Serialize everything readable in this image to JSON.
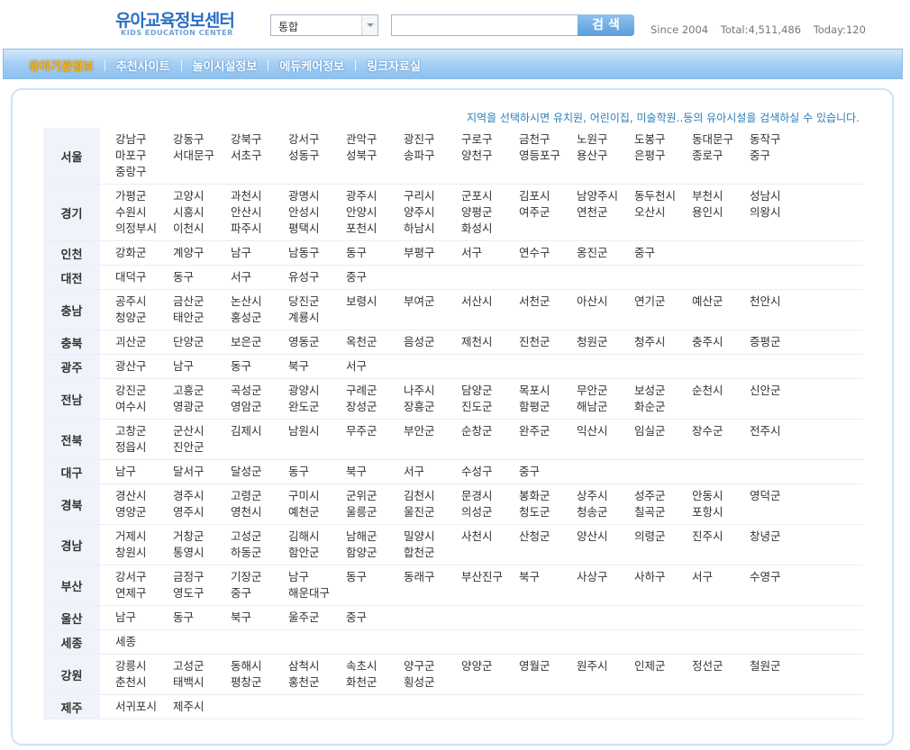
{
  "header": {
    "logo_kr": "유아교육정보센터",
    "logo_en": "KIDS EDUCATION CENTER",
    "search_scope": "통합",
    "search_button": "검 색",
    "since": "Since 2004",
    "total": "Total:4,511,486",
    "today": "Today:120"
  },
  "nav": [
    {
      "label": "유아기관정보"
    },
    {
      "label": "추천사이트"
    },
    {
      "label": "놀이시설정보"
    },
    {
      "label": "에듀케어정보"
    },
    {
      "label": "링크자료실"
    }
  ],
  "colors": {
    "accent": "#2b7fb8",
    "nav_active": "#ffb400",
    "nav_bg": "#a7d0f4",
    "region_bg": "#f0f4fa"
  },
  "notice": "지역을 선택하시면 유치원, 어린이집, 미술학원..등의 유아시설을 검색하실 수 있습니다.",
  "regions": [
    {
      "name": "서울",
      "cities": [
        "강남구",
        "강동구",
        "강북구",
        "강서구",
        "관악구",
        "광진구",
        "구로구",
        "금천구",
        "노원구",
        "도봉구",
        "동대문구",
        "동작구",
        "마포구",
        "서대문구",
        "서초구",
        "성동구",
        "성북구",
        "송파구",
        "양천구",
        "영등포구",
        "용산구",
        "은평구",
        "종로구",
        "중구",
        "중랑구"
      ]
    },
    {
      "name": "경기",
      "cities": [
        "가평군",
        "고양시",
        "과천시",
        "광명시",
        "광주시",
        "구리시",
        "군포시",
        "김포시",
        "남양주시",
        "동두천시",
        "부천시",
        "성남시",
        "수원시",
        "시흥시",
        "안산시",
        "안성시",
        "안양시",
        "양주시",
        "양평군",
        "여주군",
        "연천군",
        "오산시",
        "용인시",
        "의왕시",
        "의정부시",
        "이천시",
        "파주시",
        "평택시",
        "포천시",
        "하남시",
        "화성시"
      ]
    },
    {
      "name": "인천",
      "cities": [
        "강화군",
        "계양구",
        "남구",
        "남동구",
        "동구",
        "부평구",
        "서구",
        "연수구",
        "옹진군",
        "중구"
      ]
    },
    {
      "name": "대전",
      "cities": [
        "대덕구",
        "동구",
        "서구",
        "유성구",
        "중구"
      ]
    },
    {
      "name": "충남",
      "cities": [
        "공주시",
        "금산군",
        "논산시",
        "당진군",
        "보령시",
        "부여군",
        "서산시",
        "서천군",
        "아산시",
        "연기군",
        "예산군",
        "천안시",
        "청양군",
        "태안군",
        "홍성군",
        "계룡시"
      ]
    },
    {
      "name": "충북",
      "cities": [
        "괴산군",
        "단양군",
        "보은군",
        "영동군",
        "옥천군",
        "음성군",
        "제천시",
        "진천군",
        "청원군",
        "청주시",
        "충주시",
        "증평군"
      ]
    },
    {
      "name": "광주",
      "cities": [
        "광산구",
        "남구",
        "동구",
        "북구",
        "서구"
      ]
    },
    {
      "name": "전남",
      "cities": [
        "강진군",
        "고흥군",
        "곡성군",
        "광양시",
        "구례군",
        "나주시",
        "담양군",
        "목포시",
        "무안군",
        "보성군",
        "순천시",
        "신안군",
        "여수시",
        "영광군",
        "영암군",
        "완도군",
        "장성군",
        "장흥군",
        "진도군",
        "함평군",
        "해남군",
        "화순군"
      ]
    },
    {
      "name": "전북",
      "cities": [
        "고창군",
        "군산시",
        "김제시",
        "남원시",
        "무주군",
        "부안군",
        "순창군",
        "완주군",
        "익산시",
        "임실군",
        "장수군",
        "전주시",
        "정읍시",
        "진안군"
      ]
    },
    {
      "name": "대구",
      "cities": [
        "남구",
        "달서구",
        "달성군",
        "동구",
        "북구",
        "서구",
        "수성구",
        "중구"
      ]
    },
    {
      "name": "경북",
      "cities": [
        "경산시",
        "경주시",
        "고령군",
        "구미시",
        "군위군",
        "김천시",
        "문경시",
        "봉화군",
        "상주시",
        "성주군",
        "안동시",
        "영덕군",
        "영양군",
        "영주시",
        "영천시",
        "예천군",
        "울릉군",
        "울진군",
        "의성군",
        "청도군",
        "청송군",
        "칠곡군",
        "포항시"
      ]
    },
    {
      "name": "경남",
      "cities": [
        "거제시",
        "거창군",
        "고성군",
        "김해시",
        "남해군",
        "밀양시",
        "사천시",
        "산청군",
        "양산시",
        "의령군",
        "진주시",
        "창녕군",
        "창원시",
        "통영시",
        "하동군",
        "함안군",
        "함양군",
        "합천군"
      ]
    },
    {
      "name": "부산",
      "cities": [
        "강서구",
        "금정구",
        "기장군",
        "남구",
        "동구",
        "동래구",
        "부산진구",
        "북구",
        "사상구",
        "사하구",
        "서구",
        "수영구",
        "연제구",
        "영도구",
        "중구",
        "해운대구"
      ]
    },
    {
      "name": "울산",
      "cities": [
        "남구",
        "동구",
        "북구",
        "울주군",
        "중구"
      ]
    },
    {
      "name": "세종",
      "cities": [
        "세종"
      ]
    },
    {
      "name": "강원",
      "cities": [
        "강릉시",
        "고성군",
        "동해시",
        "삼척시",
        "속초시",
        "양구군",
        "양양군",
        "영월군",
        "원주시",
        "인제군",
        "정선군",
        "철원군",
        "춘천시",
        "태백시",
        "평창군",
        "홍천군",
        "화천군",
        "횡성군"
      ]
    },
    {
      "name": "제주",
      "cities": [
        "서귀포시",
        "제주시"
      ]
    }
  ]
}
